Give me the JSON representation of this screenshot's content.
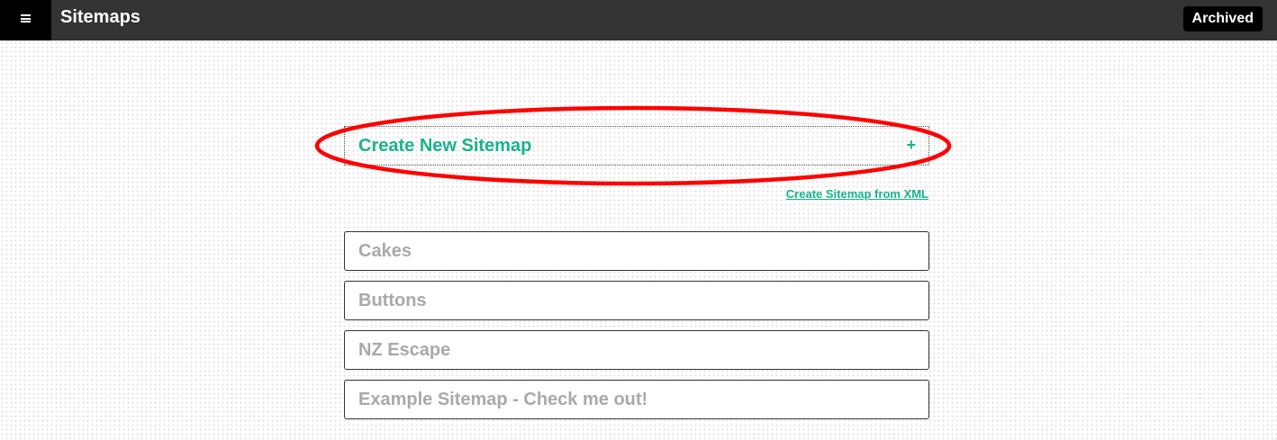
{
  "header": {
    "title": "Sitemaps",
    "menu_icon": "hamburger-icon",
    "archived_label": "Archived"
  },
  "create": {
    "label": "Create New Sitemap",
    "plus": "+",
    "from_xml_label": "Create Sitemap from XML"
  },
  "sitemaps": [
    {
      "name": "Cakes"
    },
    {
      "name": "Buttons"
    },
    {
      "name": "NZ Escape"
    },
    {
      "name": "Example Sitemap - Check me out!"
    }
  ],
  "colors": {
    "accent": "#19b38c",
    "annotation": "#ff0000",
    "topbar": "#333333",
    "item_text": "#a9a9a9"
  }
}
